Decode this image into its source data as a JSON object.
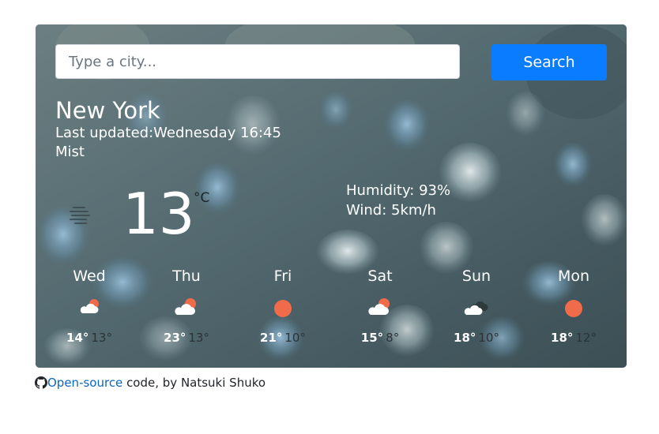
{
  "search": {
    "placeholder": "Type a city...",
    "button_label": "Search"
  },
  "current": {
    "city": "New York",
    "last_updated": "Last updated:Wednesday 16:45",
    "description": "Mist",
    "icon": "mist-icon",
    "temperature": "13",
    "unit": "°C",
    "humidity": "Humidity: 93%",
    "wind": "Wind: 5km/h"
  },
  "forecast": [
    {
      "day": "Wed",
      "icon": "cloud-sun-icon",
      "max": "14°",
      "min": "13°"
    },
    {
      "day": "Thu",
      "icon": "cloud-sun-icon",
      "max": "23°",
      "min": "13°"
    },
    {
      "day": "Fri",
      "icon": "sun-icon",
      "max": "21°",
      "min": "10°"
    },
    {
      "day": "Sat",
      "icon": "cloud-sun-icon",
      "max": "15°",
      "min": "8°"
    },
    {
      "day": "Sun",
      "icon": "dark-cloud-icon",
      "max": "18°",
      "min": "10°"
    },
    {
      "day": "Mon",
      "icon": "sun-icon",
      "max": "18°",
      "min": "12°"
    }
  ],
  "footer": {
    "icon": "github-icon",
    "link_label": "Open-source",
    "text": " code, by Natsuki Shuko"
  },
  "colors": {
    "button": "#0a7cff",
    "sun": "#f06b4a",
    "link": "#0a66c2"
  }
}
